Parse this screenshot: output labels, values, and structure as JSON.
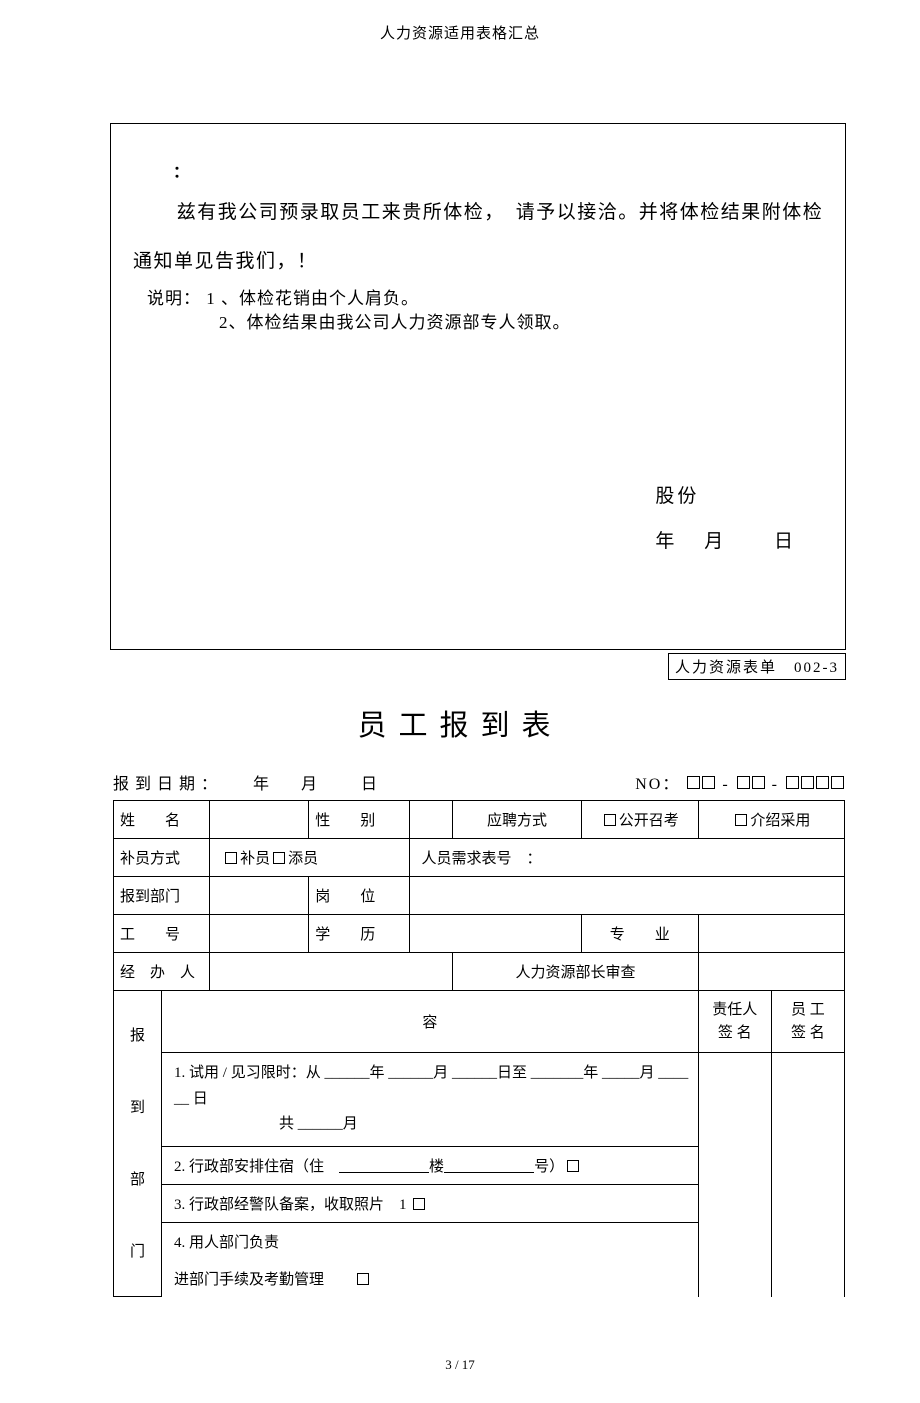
{
  "header": {
    "title": "人力资源适用表格汇总"
  },
  "letter": {
    "colon": "：",
    "body": "兹有我公司预录取员工来贵所体检，　请予以接洽。并将体检结果附体检通知单见告我们，！",
    "signature_company": "股份",
    "date_year": "年",
    "date_month": "月",
    "date_day": "日",
    "note_label": "说明：",
    "note1": "1 、体检花销由个人肩负。",
    "note2": "2、体检结果由我公司人力资源部专人领取。"
  },
  "form_id": {
    "label": "人力资源表单",
    "code": "002-3"
  },
  "title2": "员工报到表",
  "reportDate": {
    "label": "报到日期：",
    "year": "年",
    "month": "月",
    "day": "日",
    "no_label": "NO："
  },
  "row1": {
    "name": "姓　　名",
    "gender": "性　　别",
    "apply_method": "应聘方式",
    "opt_public": "公开召考",
    "opt_intro": "介绍采用"
  },
  "row2": {
    "supplement_method": "补员方式",
    "opt_buyuan": "补员",
    "opt_tianyuan": "添员",
    "demand_label": "人员需求表号　："
  },
  "row3": {
    "dept": "报到部门",
    "post": "岗　　位"
  },
  "row4": {
    "no": "工　　号",
    "edu": "学　　历",
    "major": "专　　业"
  },
  "row5": {
    "handler": "经　办　人",
    "chief": "人力资源部长审查"
  },
  "content": {
    "header": "容",
    "owner_sign": "责任人\n签 名",
    "emp_sign": "员 工\n签 名",
    "dept_label": "报\n\n到\n\n部\n\n门",
    "line1": "1. 试用 / 见习限时：从 ______年 ______月 ______日至 _______年 _____月 ______ 日\n　　　　　　　共 ______月",
    "line2_pre": "2. 行政部安排住宿（住　",
    "line2_b": "楼",
    "line2_post": "号）",
    "line3": "3. 行政部经警队备案，收取照片　1 ",
    "line4": "4. 用人部门负责",
    "line5": "进部门手续及考勤管理　　"
  },
  "footer": "3 / 17"
}
